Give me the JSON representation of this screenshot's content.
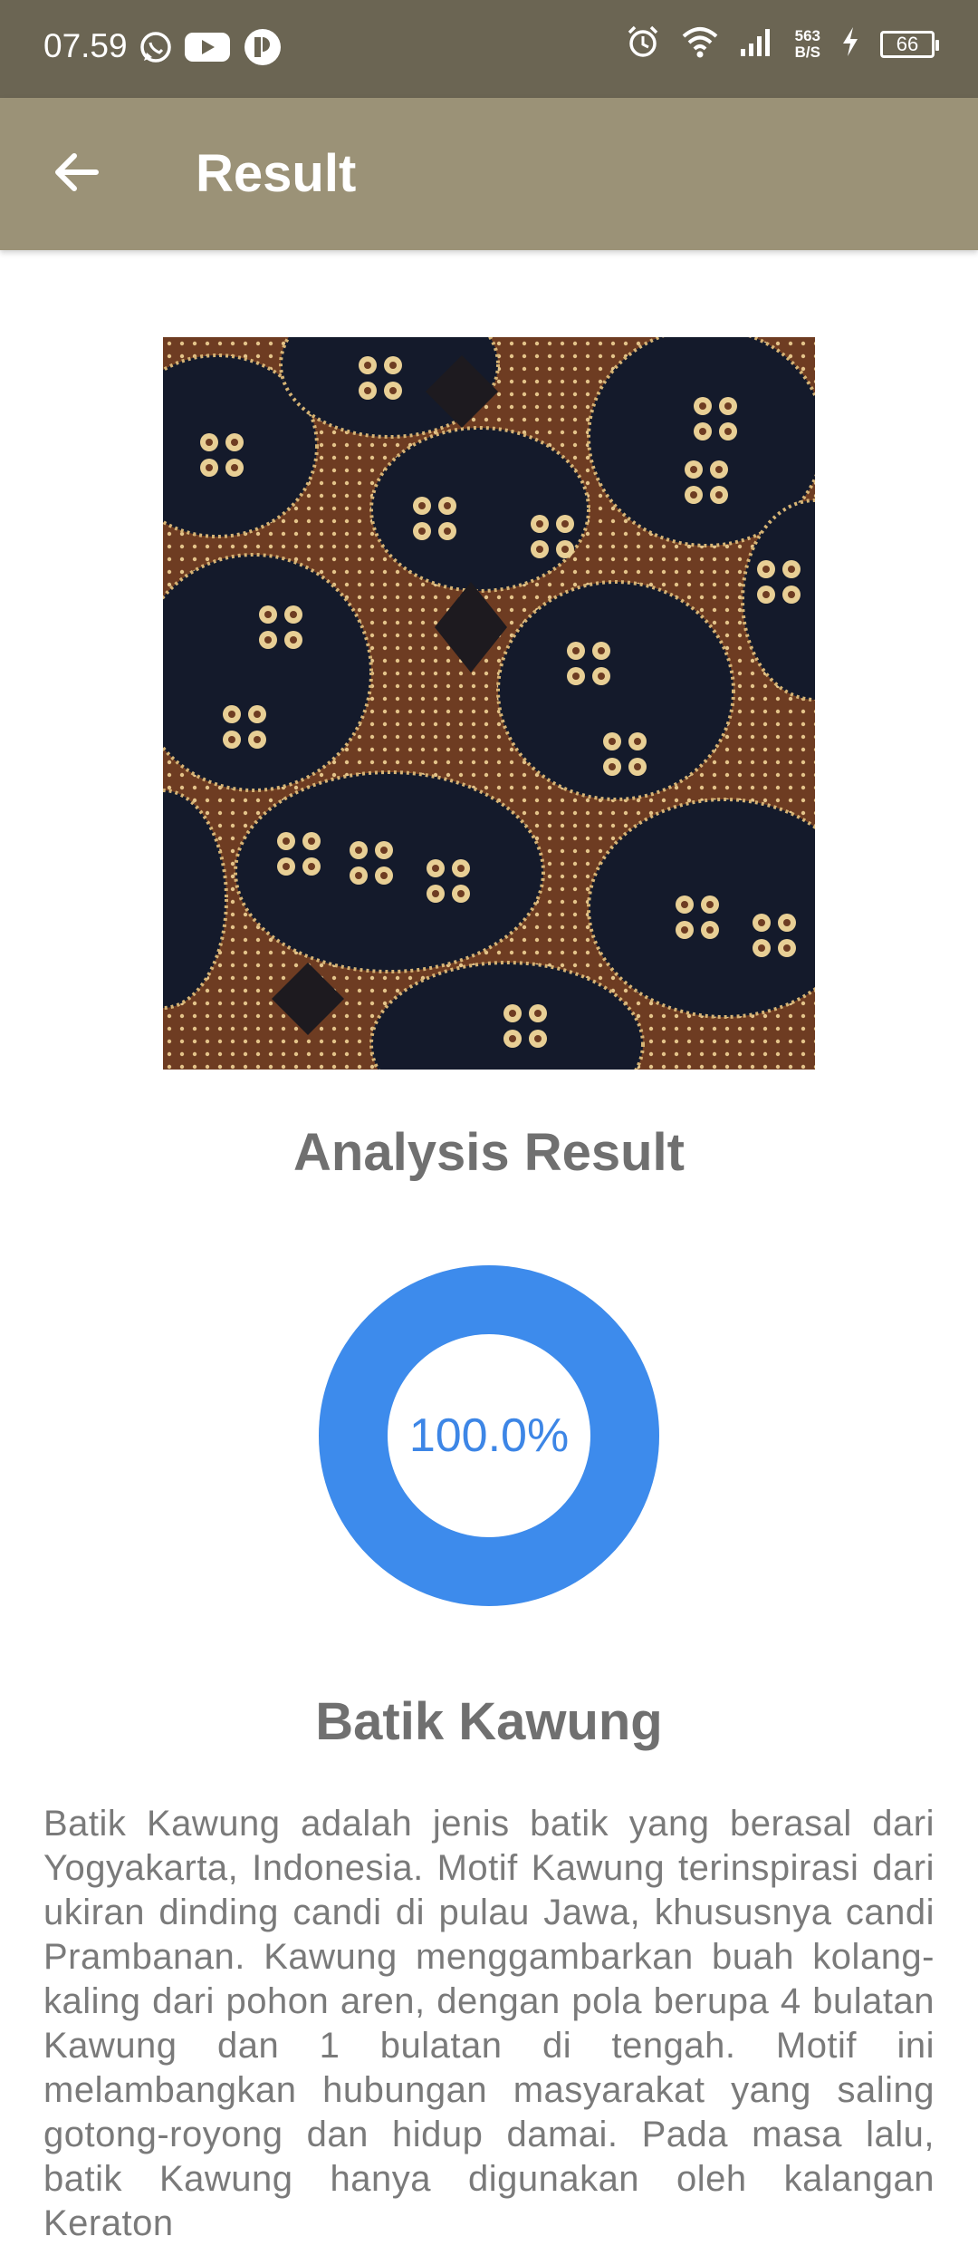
{
  "status_bar": {
    "time": "07.59",
    "speed_value": "563",
    "speed_unit": "B/S",
    "battery": "66",
    "icons": [
      "whatsapp-icon",
      "youtube-icon",
      "app-icon",
      "alarm-icon",
      "wifi-icon",
      "signal-icon",
      "charging-icon"
    ]
  },
  "appbar": {
    "title": "Result",
    "back_icon": "arrow-back-icon"
  },
  "main": {
    "image_alt": "batik-photo",
    "analysis_title": "Analysis Result",
    "confidence_text": "100.0%",
    "confidence_fraction": 1.0,
    "donut_color": "#3d8bec",
    "result_name": "Batik Kawung",
    "description": "Batik Kawung adalah jenis batik yang berasal dari Yogyakarta, Indonesia. Motif Kawung terinspirasi dari ukiran dinding candi di pulau Jawa, khususnya candi Prambanan. Kawung menggambarkan buah kolang-kaling dari pohon aren, dengan pola berupa 4 bulatan Kawung dan 1 bulatan di tengah. Motif ini melambangkan hubungan masyarakat yang saling gotong-royong dan hidup damai. Pada masa lalu, batik Kawung hanya digunakan oleh kalangan Keraton"
  }
}
